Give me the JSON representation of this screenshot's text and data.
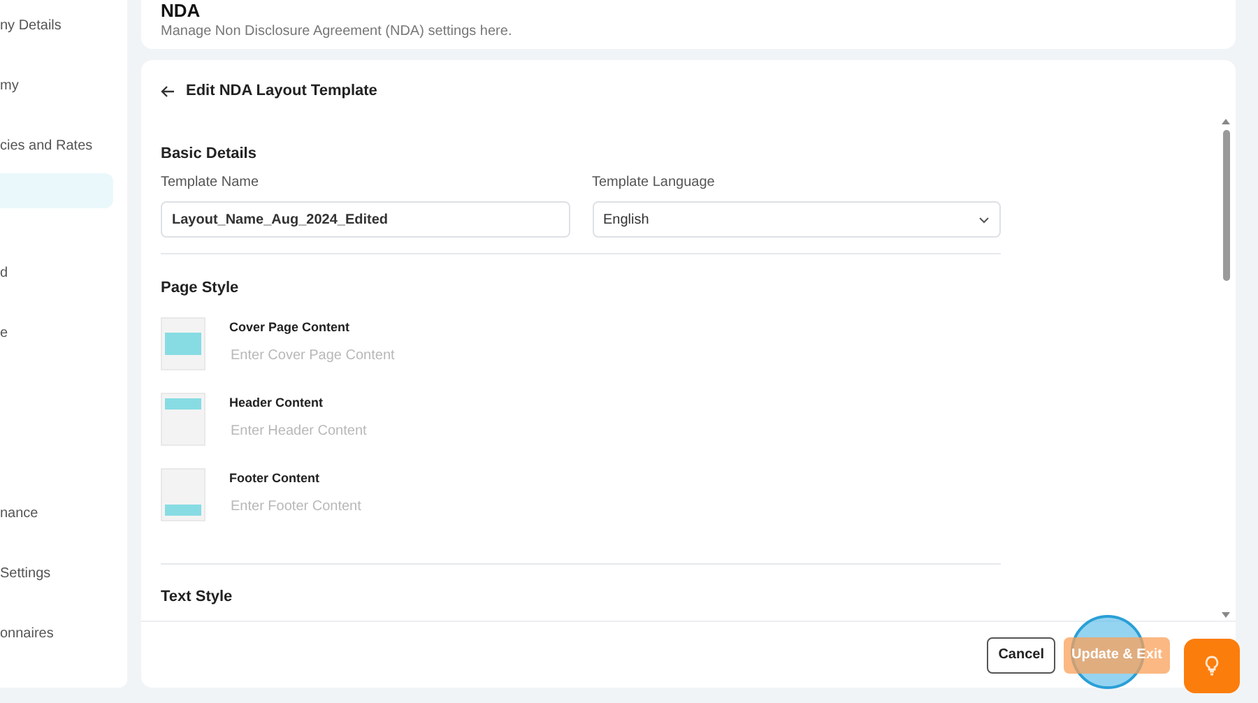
{
  "sidebar": {
    "items": [
      {
        "label": "ny Details",
        "selected": false
      },
      {
        "label": "my",
        "selected": false
      },
      {
        "label": "cies and Rates",
        "selected": false
      },
      {
        "selected": true
      },
      {
        "label": "d",
        "selected": false
      },
      {
        "label": "e",
        "selected": false
      },
      {
        "label": "nance",
        "selected": false
      },
      {
        "label": "Settings",
        "selected": false
      },
      {
        "label": "onnaires",
        "selected": false
      }
    ]
  },
  "header": {
    "title": "NDA",
    "subtitle": "Manage Non Disclosure Agreement (NDA) settings here."
  },
  "editor": {
    "title": "Edit NDA Layout Template",
    "basic_details": {
      "heading": "Basic Details",
      "template_name": {
        "label": "Template Name",
        "value": "Layout_Name_Aug_2024_Edited"
      },
      "template_language": {
        "label": "Template Language",
        "value": "English"
      }
    },
    "page_style": {
      "heading": "Page Style",
      "items": [
        {
          "kind": "cover",
          "label": "Cover Page Content",
          "placeholder": "Enter Cover Page Content"
        },
        {
          "kind": "header",
          "label": "Header Content",
          "placeholder": "Enter Header Content"
        },
        {
          "kind": "footer",
          "label": "Footer Content",
          "placeholder": "Enter Footer Content"
        }
      ]
    },
    "text_style": {
      "heading": "Text Style"
    }
  },
  "footer_buttons": [
    {
      "kind": "secondary",
      "label": "Cancel"
    },
    {
      "kind": "primary",
      "label": "Update & Exit"
    }
  ]
}
